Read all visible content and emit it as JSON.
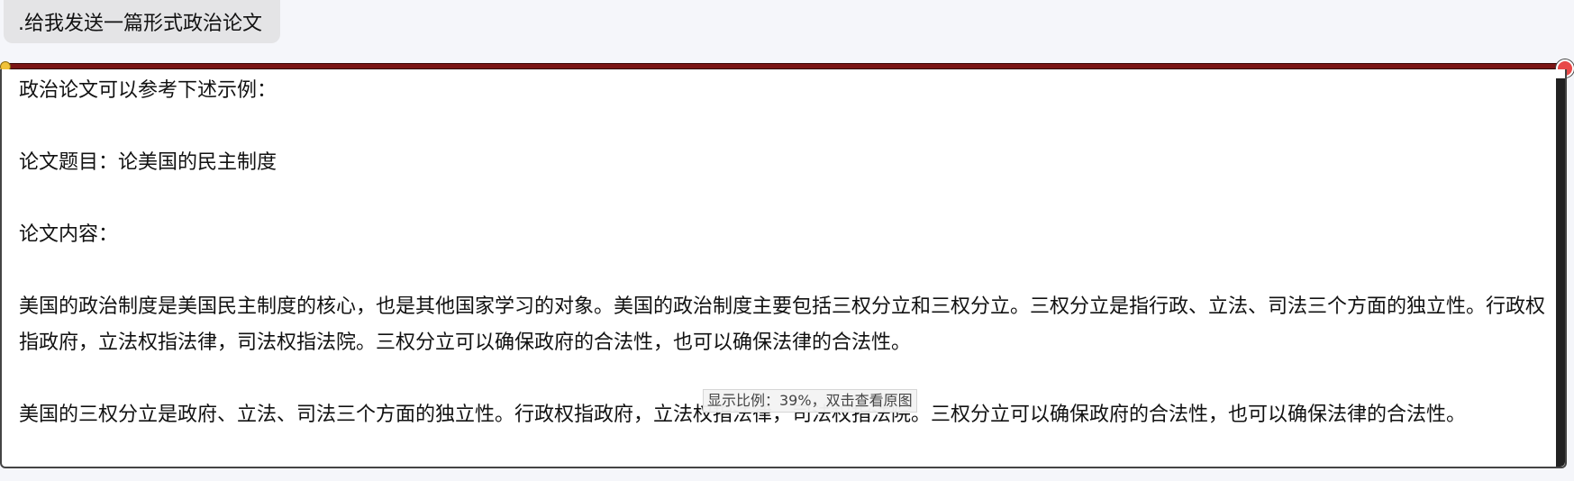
{
  "user_message": {
    "text": ".给我发送一篇形式政治论文"
  },
  "response": {
    "intro": "政治论文可以参考下述示例：",
    "title_line": "论文题目：论美国的民主制度",
    "content_label": "论文内容：",
    "paragraph_1": "美国的政治制度是美国民主制度的核心，也是其他国家学习的对象。美国的政治制度主要包括三权分立和三权分立。三权分立是指行政、立法、司法三个方面的独立性。行政权指政府，立法权指法律，司法权指法院。三权分立可以确保政府的合法性，也可以确保法律的合法性。",
    "paragraph_2": "美国的三权分立是政府、立法、司法三个方面的独立性。行政权指政府，立法权指法律，司法权指法院。三权分立可以确保政府的合法性，也可以确保法律的合法性。"
  },
  "image_viewer": {
    "zoom_tooltip": "显示比例：39%，双击查看原图"
  },
  "icons": {
    "corner_left": "sticker-dot-icon",
    "corner_right": "close-badge-icon"
  },
  "colors": {
    "top_bar": "#7a1414",
    "bubble": "#e4e4e6",
    "panel_border": "#444444"
  }
}
